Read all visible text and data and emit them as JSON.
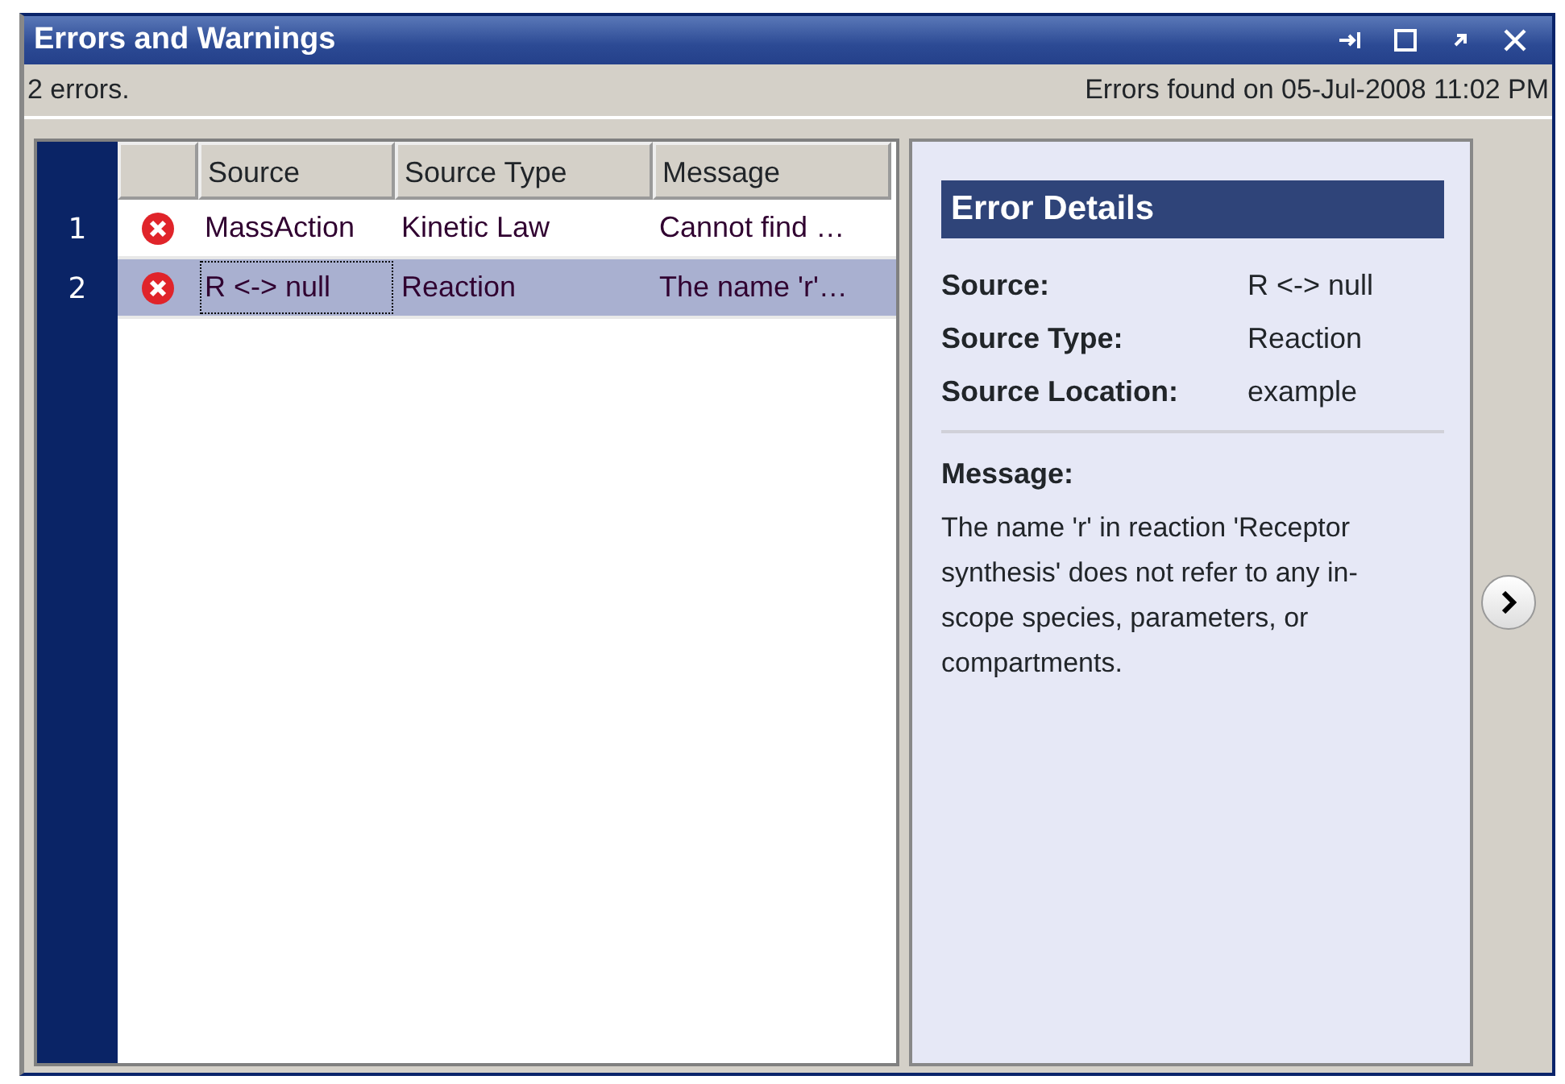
{
  "window": {
    "title": "Errors and Warnings"
  },
  "status_bar": {
    "count": "2 errors.",
    "found": "Errors found on 05-Jul-2008 11:02 PM"
  },
  "table": {
    "columns": [
      "Source",
      "Source Type",
      "Message"
    ],
    "rows": [
      {
        "number": "1",
        "source": "MassAction",
        "source_type": "Kinetic Law",
        "message": "Cannot find …",
        "selected": false
      },
      {
        "number": "2",
        "source": "R <-> null",
        "source_type": "Reaction",
        "message": "The name 'r'…",
        "selected": true
      }
    ]
  },
  "details": {
    "title": "Error Details",
    "fields": [
      {
        "label": "Source:",
        "value": "R <-> null"
      },
      {
        "label": "Source Type:",
        "value": "Reaction"
      },
      {
        "label": "Source Location:",
        "value": "example"
      }
    ],
    "message_label": "Message:",
    "message": "The name 'r' in reaction 'Receptor synthesis' does not refer to any in-scope species, parameters, or compartments."
  }
}
